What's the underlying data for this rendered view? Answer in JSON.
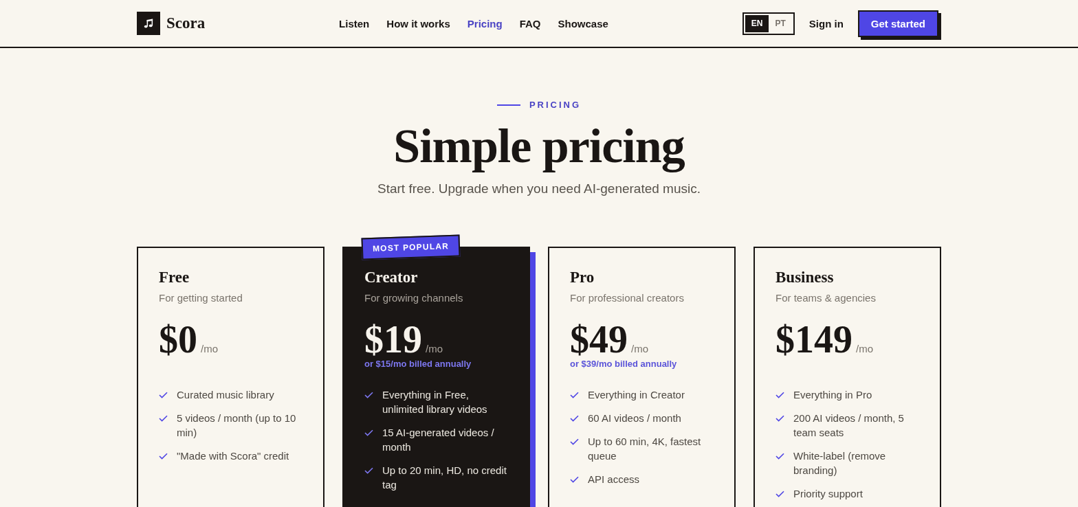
{
  "header": {
    "brand": "Scora",
    "nav": [
      {
        "label": "Listen",
        "selected": false
      },
      {
        "label": "How it works",
        "selected": false
      },
      {
        "label": "Pricing",
        "selected": true
      },
      {
        "label": "FAQ",
        "selected": false
      },
      {
        "label": "Showcase",
        "selected": false
      }
    ],
    "languages": [
      {
        "label": "EN",
        "selected": true
      },
      {
        "label": "PT",
        "selected": false
      }
    ],
    "sign_in": "Sign in",
    "cta": "Get started"
  },
  "hero": {
    "eyebrow": "PRICING",
    "title": "Simple pricing",
    "subtitle": "Start free. Upgrade when you need AI-generated music."
  },
  "plans": [
    {
      "name": "Free",
      "tagline": "For getting started",
      "price": "$0",
      "period": "/mo",
      "featured": false,
      "features": [
        "Curated music library",
        "5 videos / month (up to 10 min)",
        "\"Made with Scora\" credit"
      ]
    },
    {
      "name": "Creator",
      "tagline": "For growing channels",
      "price": "$19",
      "period": "/mo",
      "annual_note": "or $15/mo billed annually",
      "featured": true,
      "badge": "MOST POPULAR",
      "features": [
        "Everything in Free, unlimited library videos",
        "15 AI-generated videos / month",
        "Up to 20 min, HD, no credit tag"
      ]
    },
    {
      "name": "Pro",
      "tagline": "For professional creators",
      "price": "$49",
      "period": "/mo",
      "annual_note": "or $39/mo billed annually",
      "featured": false,
      "features": [
        "Everything in Creator",
        "60 AI videos / month",
        "Up to 60 min, 4K, fastest queue",
        "API access"
      ]
    },
    {
      "name": "Business",
      "tagline": "For teams & agencies",
      "price": "$149",
      "period": "/mo",
      "featured": false,
      "features": [
        "Everything in Pro",
        "200 AI videos / month, 5 team seats",
        "White-label (remove branding)",
        "Priority support"
      ]
    }
  ]
}
